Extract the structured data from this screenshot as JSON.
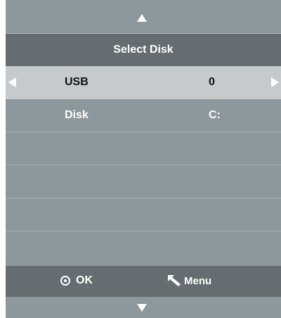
{
  "title": "Select Disk",
  "rows": [
    {
      "label": "USB",
      "value": "0",
      "selected": true
    },
    {
      "label": "Disk",
      "value": "C:",
      "selected": false
    },
    {
      "label": "",
      "value": "",
      "selected": false
    },
    {
      "label": "",
      "value": "",
      "selected": false
    },
    {
      "label": "",
      "value": "",
      "selected": false
    },
    {
      "label": "",
      "value": "",
      "selected": false
    }
  ],
  "footer": {
    "ok_label": "OK",
    "menu_label": "Menu",
    "ok_icon": "ok-circle-icon",
    "menu_icon": "return-arrow-icon"
  },
  "icons": {
    "scroll_up": "triangle-up-icon",
    "scroll_down": "triangle-down-icon",
    "value_prev": "triangle-left-icon",
    "value_next": "triangle-right-icon"
  },
  "colors": {
    "panel": "#8e979b",
    "title_bar": "#666d71",
    "selected_row": "#c6cacc",
    "text": "#ffffff",
    "selected_text": "#111111"
  }
}
